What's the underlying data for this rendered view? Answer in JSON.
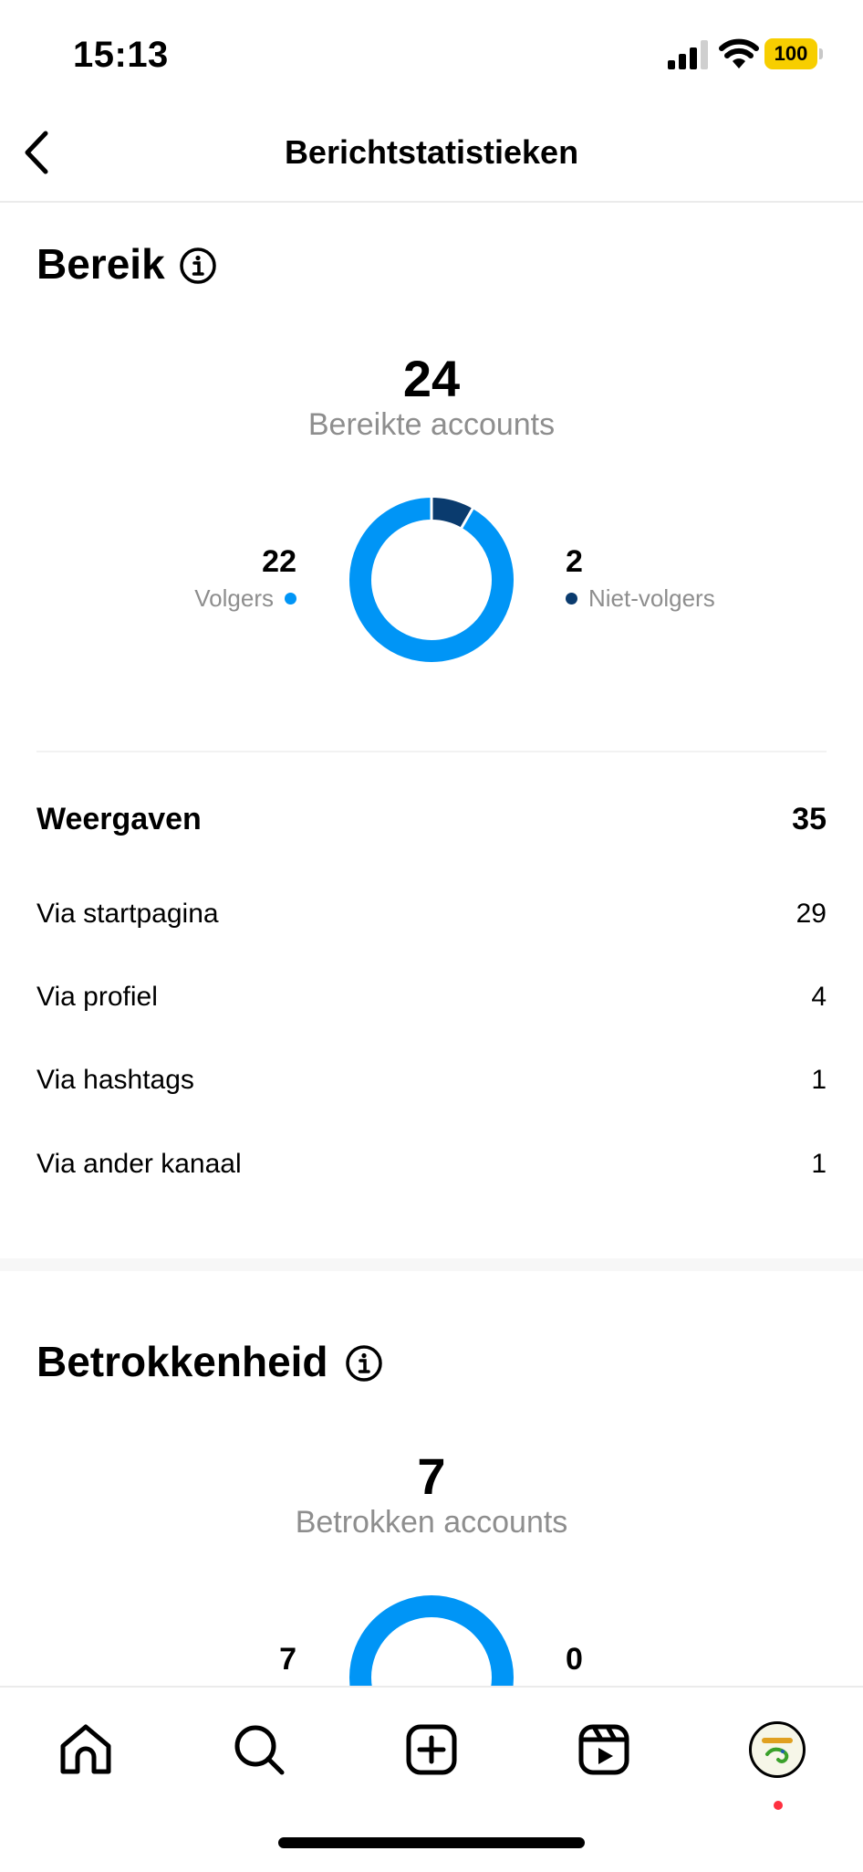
{
  "status_bar": {
    "time": "15:13",
    "battery": "100",
    "battery_color": "#f7ce00"
  },
  "nav": {
    "back_icon": "chevron-left-icon",
    "title": "Berichtstatistieken"
  },
  "reach": {
    "title": "Bereik",
    "info_icon": "info-icon",
    "total": "24",
    "total_label": "Bereikte accounts",
    "followers": {
      "value": "22",
      "label": "Volgers",
      "color": "#0095f6"
    },
    "non_followers": {
      "value": "2",
      "label": "Niet-volgers",
      "color": "#0a3b6e"
    }
  },
  "views": {
    "title": "Weergaven",
    "total": "35",
    "rows": [
      {
        "label": "Via startpagina",
        "value": "29"
      },
      {
        "label": "Via profiel",
        "value": "4"
      },
      {
        "label": "Via hashtags",
        "value": "1"
      },
      {
        "label": "Via ander kanaal",
        "value": "1"
      }
    ]
  },
  "engagement": {
    "title": "Betrokkenheid",
    "info_icon": "info-icon",
    "total": "7",
    "total_label": "Betrokken accounts",
    "followers": {
      "value": "7"
    },
    "non_followers": {
      "value": "0"
    }
  },
  "tab_bar": {
    "items": [
      {
        "name": "home",
        "icon": "home-icon"
      },
      {
        "name": "search",
        "icon": "search-icon"
      },
      {
        "name": "create",
        "icon": "plus-square-icon"
      },
      {
        "name": "reels",
        "icon": "reels-icon"
      },
      {
        "name": "profile",
        "icon": "avatar"
      }
    ],
    "notification_color": "#ff3040"
  }
}
